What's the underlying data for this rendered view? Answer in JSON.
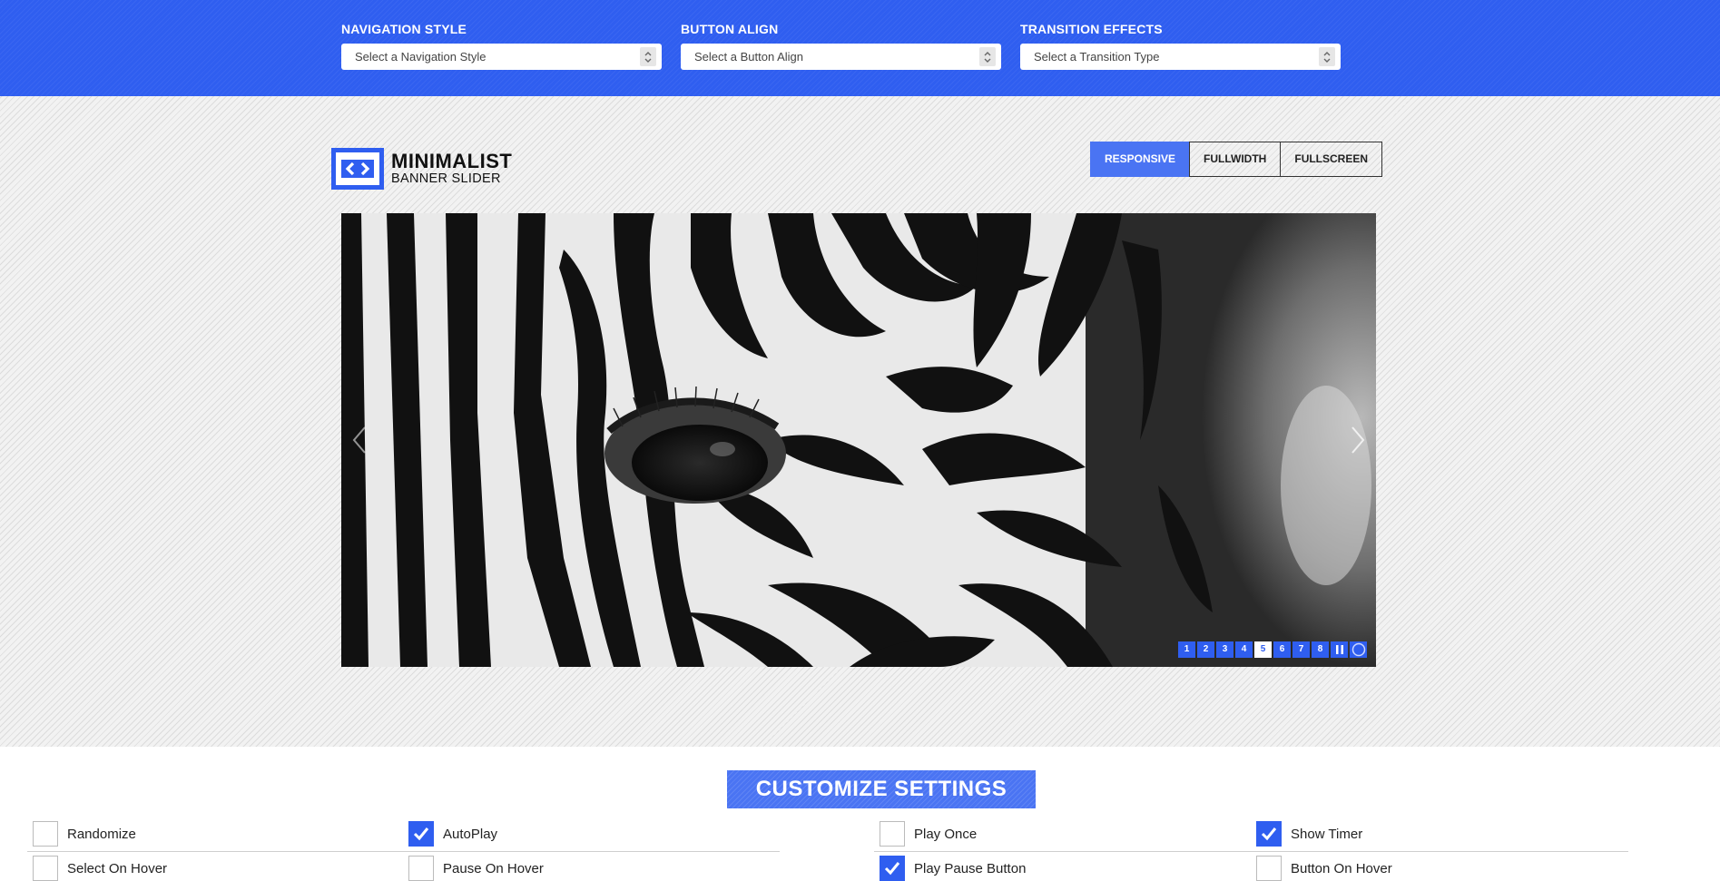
{
  "topbar": {
    "navigation_style": {
      "label": "NAVIGATION STYLE",
      "placeholder": "Select a Navigation Style"
    },
    "button_align": {
      "label": "BUTTON ALIGN",
      "placeholder": "Select a Button Align"
    },
    "transition_effects": {
      "label": "TRANSITION EFFECTS",
      "placeholder": "Select a Transition Type"
    }
  },
  "logo": {
    "line1": "MINIMALIST",
    "line2": "BANNER SLIDER"
  },
  "layout_modes": {
    "responsive": "RESPONSIVE",
    "fullwidth": "FULLWIDTH",
    "fullscreen": "FULLSCREEN",
    "active": "RESPONSIVE"
  },
  "slider": {
    "pages": [
      "1",
      "2",
      "3",
      "4",
      "5",
      "6",
      "7",
      "8"
    ],
    "current_page": "5",
    "prev_icon": "chevron-left-icon",
    "next_icon": "chevron-right-icon"
  },
  "settings": {
    "title": "CUSTOMIZE SETTINGS",
    "options": {
      "randomize": {
        "label": "Randomize",
        "checked": false
      },
      "autoplay": {
        "label": "AutoPlay",
        "checked": true
      },
      "play_once": {
        "label": "Play Once",
        "checked": false
      },
      "show_timer": {
        "label": "Show Timer",
        "checked": true
      },
      "select_on_hover": {
        "label": "Select On Hover",
        "checked": false
      },
      "pause_on_hover": {
        "label": "Pause On Hover",
        "checked": false
      },
      "play_pause_button": {
        "label": "Play Pause Button",
        "checked": true
      },
      "button_on_hover": {
        "label": "Button On Hover",
        "checked": false
      }
    }
  },
  "colors": {
    "accent": "#2f5ef0",
    "accent_light": "#4a74f3",
    "stage_bg": "#f2f2f2"
  }
}
